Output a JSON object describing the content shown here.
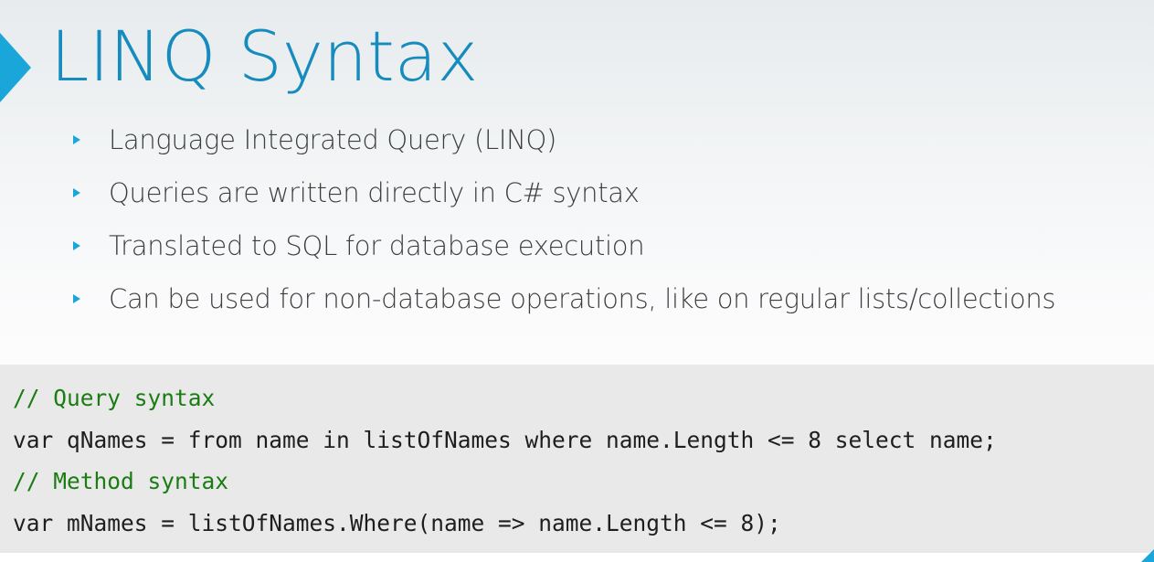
{
  "slide": {
    "title": "LINQ Syntax",
    "accent_color": "#1aa6d8",
    "title_color": "#168bbd",
    "bullets": [
      {
        "text": "Language Integrated Query (LINQ)"
      },
      {
        "text": "Queries are written directly in C# syntax"
      },
      {
        "text": "Translated to SQL for database execution"
      },
      {
        "text": "Can be used for non-database operations, like on regular lists/collections"
      }
    ]
  },
  "code": {
    "background_color": "#e9e9e9",
    "comment_color": "#1a7c12",
    "lines": [
      {
        "text": "// Query syntax",
        "kind": "comment"
      },
      {
        "text": "var qNames = from name in listOfNames where name.Length <= 8 select name;",
        "kind": "code"
      },
      {
        "text": "// Method syntax",
        "kind": "comment"
      },
      {
        "text": "var mNames = listOfNames.Where(name => name.Length <= 8);",
        "kind": "code"
      }
    ]
  },
  "icons": {
    "title_marker": "triangle-right-icon",
    "bullet_marker": "triangle-right-icon",
    "corner": "corner-triangle-icon"
  }
}
